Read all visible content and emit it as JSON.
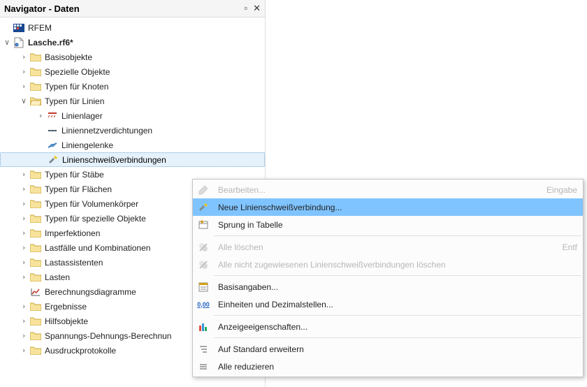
{
  "panel": {
    "title": "Navigator - Daten",
    "pin_tooltip": "Pin",
    "close_tooltip": "Schließen"
  },
  "root": {
    "app": "RFEM",
    "file": "Lasche.rf6*"
  },
  "tree": {
    "basisobjekte": "Basisobjekte",
    "spezielle_objekte": "Spezielle Objekte",
    "typen_knoten": "Typen für Knoten",
    "typen_linien": "Typen für Linien",
    "linienlager": "Linienlager",
    "liniennetzverdichtungen": "Liniennetzverdichtungen",
    "liniengelenke": "Liniengelenke",
    "linienschweiss": "Linienschweißverbindungen",
    "typen_staebe": "Typen für Stäbe",
    "typen_flaechen": "Typen für Flächen",
    "typen_volumen": "Typen für Volumenkörper",
    "typen_spezielle": "Typen für spezielle Objekte",
    "imperfektionen": "Imperfektionen",
    "lastfaelle": "Lastfälle und Kombinationen",
    "lastassistenten": "Lastassistenten",
    "lasten": "Lasten",
    "berechnung": "Berechnungsdiagramme",
    "ergebnisse": "Ergebnisse",
    "hilfsobjekte": "Hilfsobjekte",
    "spannungs": "Spannungs-Dehnungs-Berechnun",
    "ausdruck": "Ausdruckprotokolle"
  },
  "menu": {
    "bearbeiten": "Bearbeiten...",
    "bearbeiten_shortcut": "Eingabe",
    "neue": "Neue Linienschweißverbindung...",
    "sprung": "Sprung in Tabelle",
    "alle_loeschen": "Alle löschen",
    "alle_loeschen_shortcut": "Entf",
    "alle_nicht": "Alle nicht zugewiesenen Linienschweißverbindungen löschen",
    "basisangaben": "Basisangaben...",
    "einheiten": "Einheiten und Dezimalstellen...",
    "anzeige": "Anzeigeeigenschaften...",
    "erweitern": "Auf Standard erweitern",
    "reduzieren": "Alle reduzieren"
  }
}
